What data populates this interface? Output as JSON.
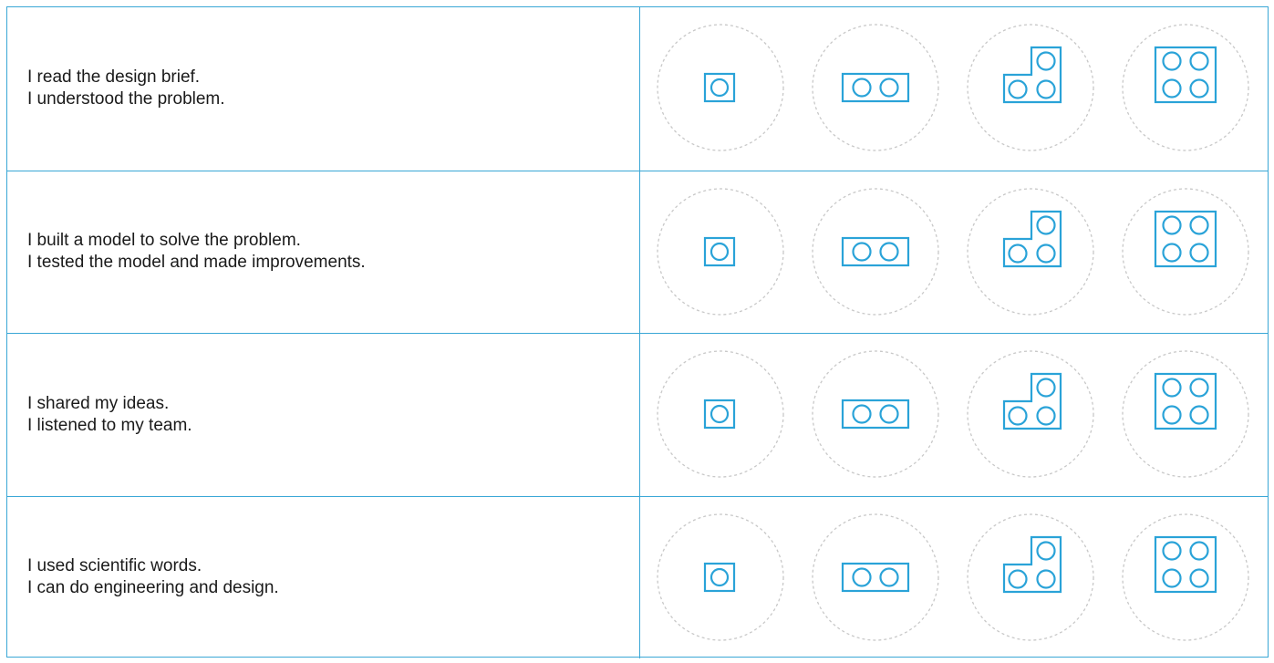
{
  "rows": [
    {
      "line1": "I read the design brief.",
      "line2": "I understood the problem."
    },
    {
      "line1": "I built a model to solve the problem.",
      "line2": "I tested the model and made improvements."
    },
    {
      "line1": "I shared my ideas.",
      "line2": "I listened to my team."
    },
    {
      "line1": "I used scientific words.",
      "line2": "I can do engineering and design."
    }
  ],
  "rating_options": [
    {
      "icon": "brick-1x1-icon",
      "studs": 1
    },
    {
      "icon": "brick-1x2-icon",
      "studs": 2
    },
    {
      "icon": "brick-L-icon",
      "studs": 3
    },
    {
      "icon": "brick-2x2-icon",
      "studs": 4
    }
  ],
  "colors": {
    "border": "#3aa7d6",
    "brick": "#2aa3d8",
    "dashed_circle": "#c8c8c8",
    "text": "#1a1a1a"
  }
}
